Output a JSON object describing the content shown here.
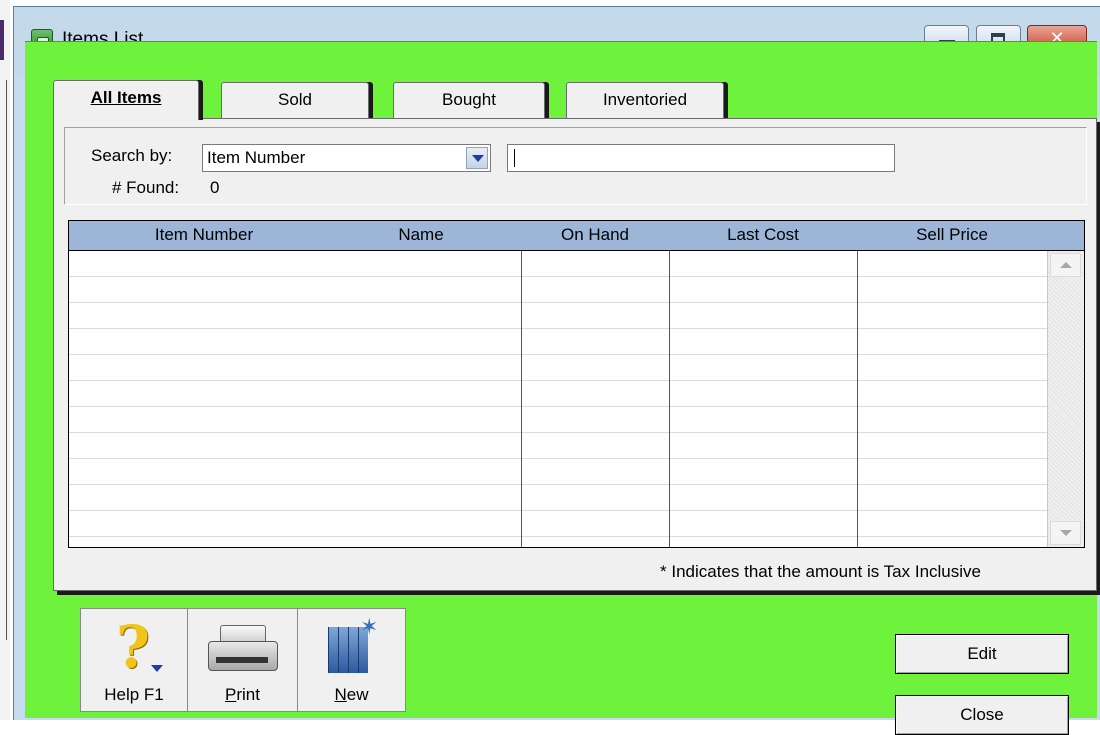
{
  "window": {
    "title": "Items List"
  },
  "tabs": [
    {
      "label": "All Items",
      "active": true
    },
    {
      "label": "Sold"
    },
    {
      "label": "Bought"
    },
    {
      "label": "Inventoried"
    }
  ],
  "search": {
    "label": "Search by:",
    "selected": "Item Number",
    "text_value": "",
    "found_label": "# Found:",
    "found_value": "0"
  },
  "table": {
    "columns": [
      "Item Number",
      "Name",
      "On Hand",
      "Last Cost",
      "Sell Price"
    ],
    "rows": []
  },
  "note": "* Indicates that the amount is Tax Inclusive",
  "toolbar": {
    "help": "Help F1",
    "print": "Print",
    "new": "New"
  },
  "buttons": {
    "edit": "Edit",
    "close": "Close"
  },
  "colors": {
    "client_background": "#6ef23b",
    "table_header": "#9db6d8",
    "window_frame": "#c4d9ea"
  },
  "icons": [
    "app-icon",
    "minimize-icon",
    "maximize-icon",
    "close-icon",
    "dropdown-arrow-icon",
    "help-icon",
    "printer-icon",
    "new-item-icon",
    "scroll-up-icon",
    "scroll-down-icon"
  ]
}
